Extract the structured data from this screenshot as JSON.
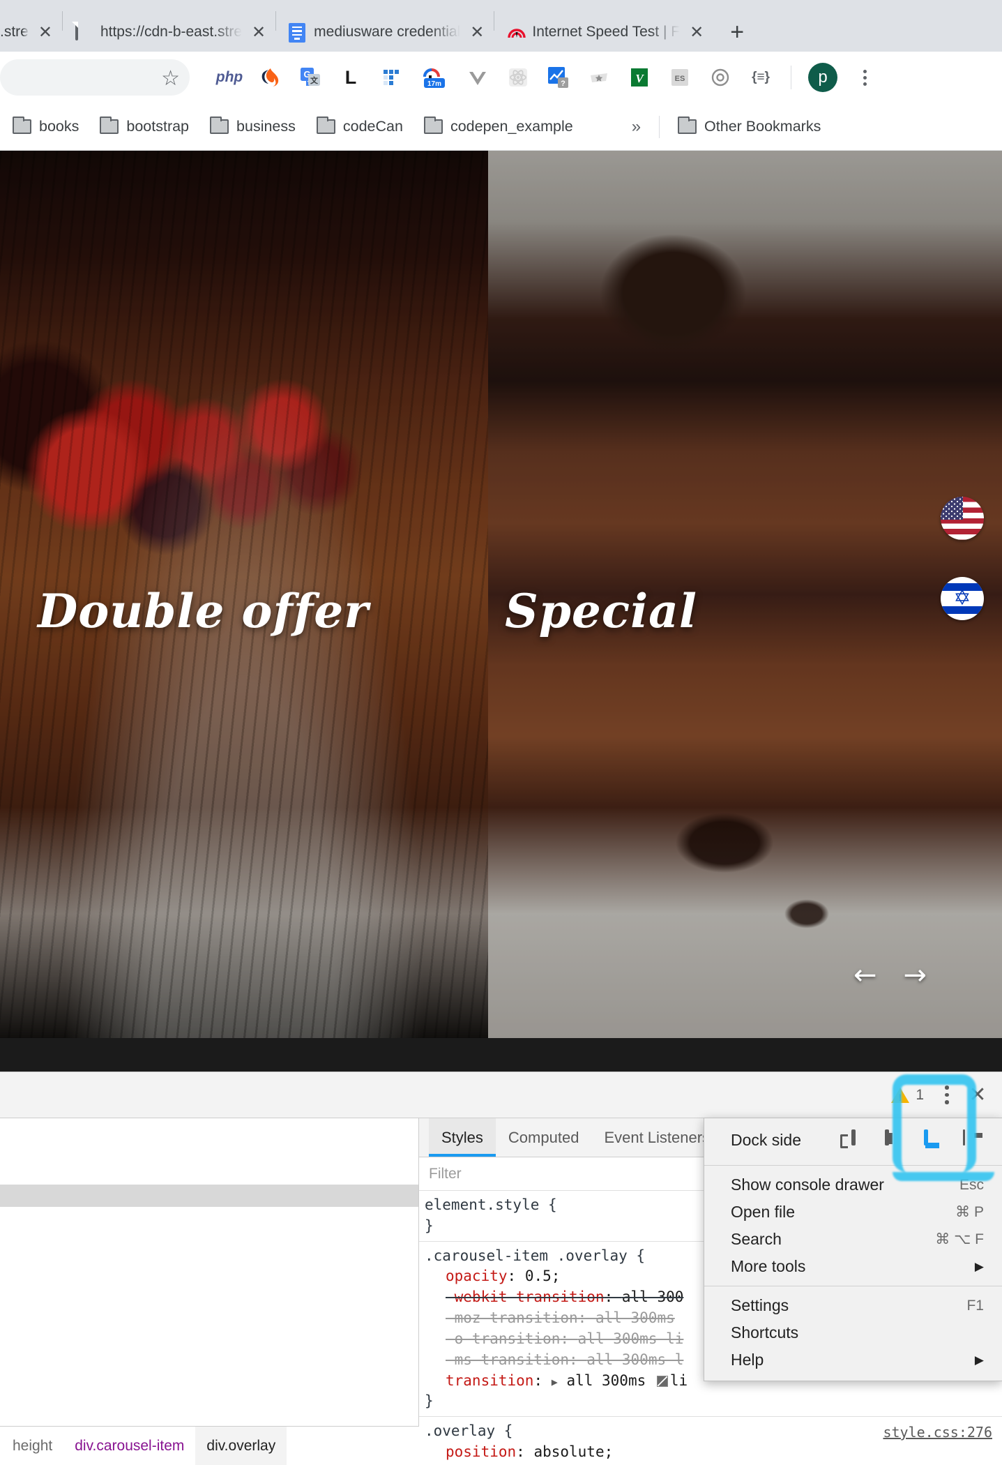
{
  "browser": {
    "tabs": [
      {
        "title": ".stre",
        "favicon": "none-icon",
        "truncated_left": true
      },
      {
        "title": "https://cdn-b-east.stre",
        "favicon": "document-icon"
      },
      {
        "title": "mediusware credential",
        "favicon": "google-docs-icon"
      },
      {
        "title": "Internet Speed Test | F",
        "favicon": "speedtest-icon"
      }
    ],
    "new_tab_label": "+",
    "tab_close_label": "✕",
    "toolbar": {
      "bookmark_star": "star-icon",
      "extensions": [
        {
          "name": "php-extension-icon",
          "label": "php"
        },
        {
          "name": "sourcegraph-extension-icon",
          "label": ""
        },
        {
          "name": "google-translate-extension-icon",
          "label": "G"
        },
        {
          "name": "lastpass-extension-icon",
          "label": "L"
        },
        {
          "name": "todoist-extension-icon",
          "label": ""
        },
        {
          "name": "timer-extension-icon",
          "label": "17m"
        },
        {
          "name": "vuejs-devtools-icon",
          "label": ""
        },
        {
          "name": "react-devtools-icon",
          "label": ""
        },
        {
          "name": "analytics-extension-icon",
          "label": "?"
        },
        {
          "name": "star-extension-icon",
          "label": ""
        },
        {
          "name": "vysor-extension-icon",
          "label": "V"
        },
        {
          "name": "es-extension-icon",
          "label": "ES"
        },
        {
          "name": "target-extension-icon",
          "label": ""
        },
        {
          "name": "json-viewer-extension-icon",
          "label": "{≡}"
        }
      ],
      "profile_initial": "p",
      "profile_color": "#0f5c4a",
      "menu_label": "chrome-menu-icon"
    },
    "bookmarks": {
      "items": [
        {
          "label": "books"
        },
        {
          "label": "bootstrap"
        },
        {
          "label": "business"
        },
        {
          "label": "codeCan"
        },
        {
          "label": "codepen_example"
        }
      ],
      "overflow_label": "»",
      "other_bookmarks_label": "Other Bookmarks"
    }
  },
  "page": {
    "carousel": {
      "slides": [
        {
          "title": "Double offer",
          "image": "berry-chocolate-cake-photo"
        },
        {
          "title": "Special",
          "image": "chocolate-cake-slice-photo"
        }
      ],
      "prev_arrow": "←",
      "next_arrow": "→"
    },
    "language_switcher": [
      {
        "name": "flag-us",
        "label": "United States"
      },
      {
        "name": "flag-israel",
        "label": "Israel"
      }
    ]
  },
  "devtools": {
    "topbar": {
      "warning_count": "1",
      "more_options_label": "⋮",
      "close_label": "✕"
    },
    "sidebar_tabs": [
      {
        "label": "Styles",
        "active": true
      },
      {
        "label": "Computed",
        "active": false
      },
      {
        "label": "Event Listeners",
        "active": false
      }
    ],
    "filter_placeholder": "Filter",
    "style_rules": [
      {
        "selector": "element.style {",
        "close": "}",
        "source": "",
        "declarations": []
      },
      {
        "selector": ".carousel-item .overlay {",
        "close": "}",
        "source": "",
        "declarations": [
          {
            "prop": "opacity",
            "value": "0.5;",
            "strike": false,
            "muted": false
          },
          {
            "prop": "-webkit-transition",
            "value": "all 300",
            "strike": true,
            "muted": false
          },
          {
            "prop": "-moz-transition",
            "value": "all 300ms",
            "strike": true,
            "muted": true
          },
          {
            "prop": "-o-transition",
            "value": "all 300ms li",
            "strike": true,
            "muted": true
          },
          {
            "prop": "-ms-transition",
            "value": "all 300ms l",
            "strike": true,
            "muted": true
          },
          {
            "prop": "transition",
            "value": "all 300ms",
            "value2": "li",
            "strike": false,
            "muted": false,
            "expandable": true,
            "swatch": true
          }
        ]
      },
      {
        "selector": ".overlay {",
        "close": "",
        "source": "style.css:276",
        "declarations": [
          {
            "prop": "position",
            "value": "absolute;",
            "strike": false,
            "muted": false
          }
        ]
      }
    ],
    "breadcrumb": [
      {
        "label": "height",
        "kind": "plain"
      },
      {
        "label": "div.carousel-item",
        "kind": "tag"
      },
      {
        "label": "div.overlay",
        "kind": "selected"
      }
    ],
    "menu": {
      "dock_side_label": "Dock side",
      "dock_options": [
        {
          "name": "undock-into-separate-window-icon",
          "selected": false
        },
        {
          "name": "dock-to-left-icon",
          "selected": false
        },
        {
          "name": "dock-to-bottom-icon",
          "selected": true
        },
        {
          "name": "dock-to-right-icon",
          "selected": false
        }
      ],
      "items": [
        {
          "label": "Show console drawer",
          "shortcut": "Esc",
          "arrow": false
        },
        {
          "label": "Open file",
          "shortcut": "⌘ P",
          "arrow": false
        },
        {
          "label": "Search",
          "shortcut": "⌘ ⌥ F",
          "arrow": false
        },
        {
          "label": "More tools",
          "shortcut": "",
          "arrow": true
        },
        {
          "label": "Settings",
          "shortcut": "F1",
          "arrow": false,
          "group": 2
        },
        {
          "label": "Shortcuts",
          "shortcut": "",
          "arrow": false,
          "group": 2
        },
        {
          "label": "Help",
          "shortcut": "",
          "arrow": true,
          "group": 2
        }
      ]
    },
    "annotation": {
      "name": "blue-highlight-box",
      "color": "#37c5f0"
    }
  }
}
